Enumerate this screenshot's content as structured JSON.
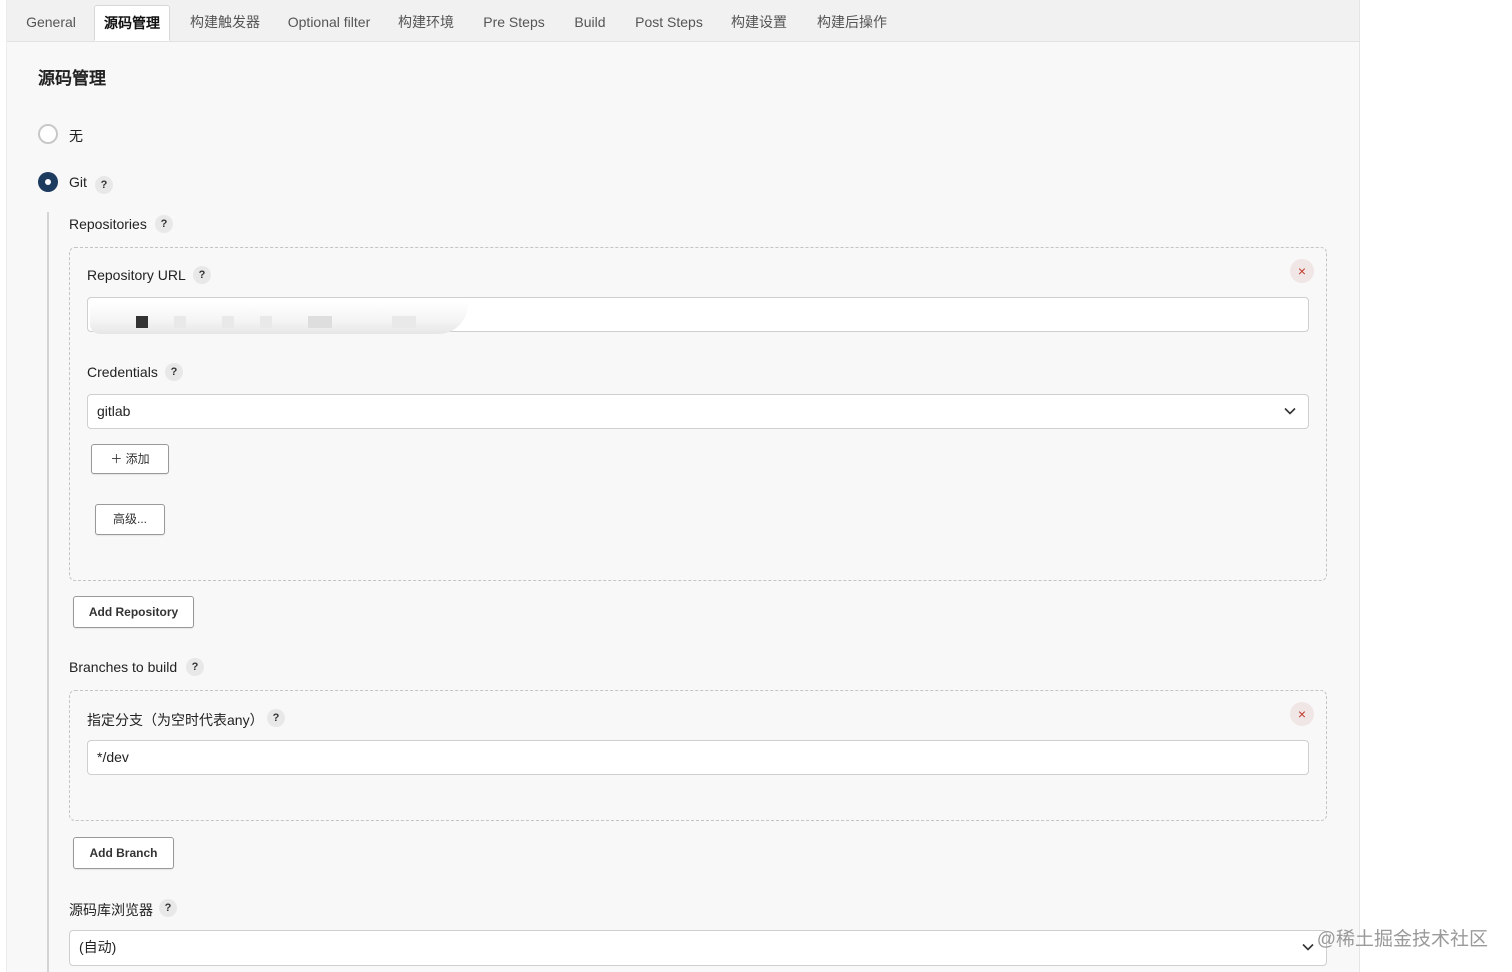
{
  "tabs": [
    {
      "label": "General"
    },
    {
      "label": "源码管理"
    },
    {
      "label": "构建触发器"
    },
    {
      "label": "Optional filter"
    },
    {
      "label": "构建环境"
    },
    {
      "label": "Pre Steps"
    },
    {
      "label": "Build"
    },
    {
      "label": "Post Steps"
    },
    {
      "label": "构建设置"
    },
    {
      "label": "构建后操作"
    }
  ],
  "active_tab": "源码管理",
  "scm": {
    "title": "源码管理",
    "option_none": "无",
    "option_git": "Git",
    "selected": "Git",
    "help_glyph": "?",
    "repositories": {
      "label": "Repositories",
      "repo_url_label": "Repository URL",
      "repo_url_value": "",
      "credentials_label": "Credentials",
      "credentials_value": "gitlab",
      "add_button": "＋ 添加",
      "advanced_button": "高级...",
      "remove_glyph": "×"
    },
    "add_repository_button": "Add Repository",
    "branches": {
      "label": "Branches to build",
      "spec_label": "指定分支（为空时代表any）",
      "spec_value": "*/dev",
      "remove_glyph": "×"
    },
    "add_branch_button": "Add Branch",
    "browser": {
      "label": "源码库浏览器",
      "value": "(自动)"
    }
  },
  "watermark": "@稀土掘金技术社区",
  "colors": {
    "radio_selected": "#1d3a5f",
    "remove_icon": "#c0392b",
    "panel_bg": "#f8f8f8"
  }
}
